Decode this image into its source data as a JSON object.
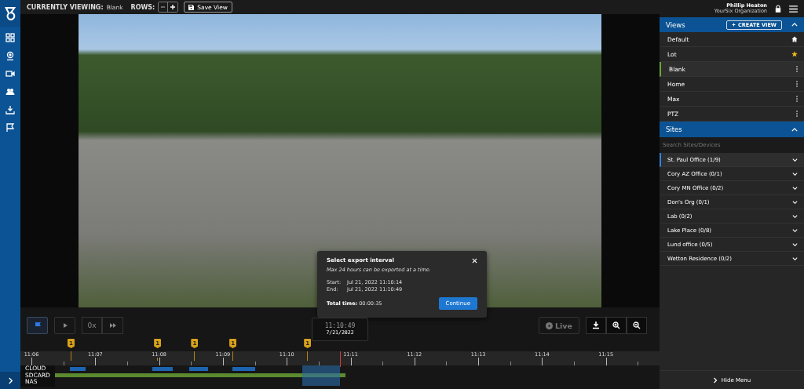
{
  "top_bar": {
    "viewing_label": "CURRENTLY VIEWING:",
    "viewing_value": "Blank",
    "rows_label": "ROWS:",
    "save_button": "Save View"
  },
  "user": {
    "name": "Phillip Heaton",
    "organization": "YourSix Organization"
  },
  "views": {
    "title": "Views",
    "create_button": "CREATE VIEW",
    "expanded": true,
    "items": [
      {
        "label": "Default",
        "kind": "home",
        "selected": false
      },
      {
        "label": "Lot",
        "kind": "favorite",
        "selected": false
      },
      {
        "label": "Blank",
        "kind": "custom",
        "selected": true
      },
      {
        "label": "Home",
        "kind": "custom",
        "selected": false
      },
      {
        "label": "Max",
        "kind": "custom",
        "selected": false
      },
      {
        "label": "PTZ",
        "kind": "custom",
        "selected": false
      }
    ]
  },
  "sites": {
    "title": "Sites",
    "expanded": true,
    "search": {
      "placeholder": "Search Sites/Devices"
    },
    "items": [
      {
        "label": "St. Paul Office (1/9)",
        "selected": true
      },
      {
        "label": "Cory AZ Office (0/1)",
        "selected": false
      },
      {
        "label": "Cory MN Office (0/2)",
        "selected": false
      },
      {
        "label": "Don's Org (0/1)",
        "selected": false
      },
      {
        "label": "Lab (0/2)",
        "selected": false
      },
      {
        "label": "Lake Place (0/8)",
        "selected": false
      },
      {
        "label": "Lund office (0/5)",
        "selected": false
      },
      {
        "label": "Wetton Residence (0/2)",
        "selected": false
      }
    ]
  },
  "export_dialog": {
    "title": "Select export interval",
    "note": "Max 24 hours can be exported at a time.",
    "start_label": "Start:",
    "start_value": "Jul 21, 2022 11:10:14",
    "end_label": "End:",
    "end_value": "Jul 21, 2022 11:10:49",
    "total_label": "Total time:",
    "total_value": "00:00:35",
    "continue_button": "Continue"
  },
  "playback": {
    "flag_active": true,
    "speed": "0x",
    "time": "11:10:49",
    "date": "7/21/2022",
    "live_button": "Live",
    "live_disabled": true
  },
  "timeline": {
    "ticks": [
      "11:06",
      "11:07",
      "11:08",
      "11:09",
      "11:10",
      "11:11",
      "11:12",
      "11:13",
      "11:14",
      "11:15"
    ],
    "markers": [
      {
        "label": "1"
      },
      {
        "label": "1"
      },
      {
        "label": "1"
      },
      {
        "label": "1"
      },
      {
        "label": "1"
      }
    ],
    "tracks": [
      "CLOUD",
      "SDCARD",
      "NAS"
    ]
  },
  "footer": {
    "hide_menu": "Hide Menu"
  }
}
